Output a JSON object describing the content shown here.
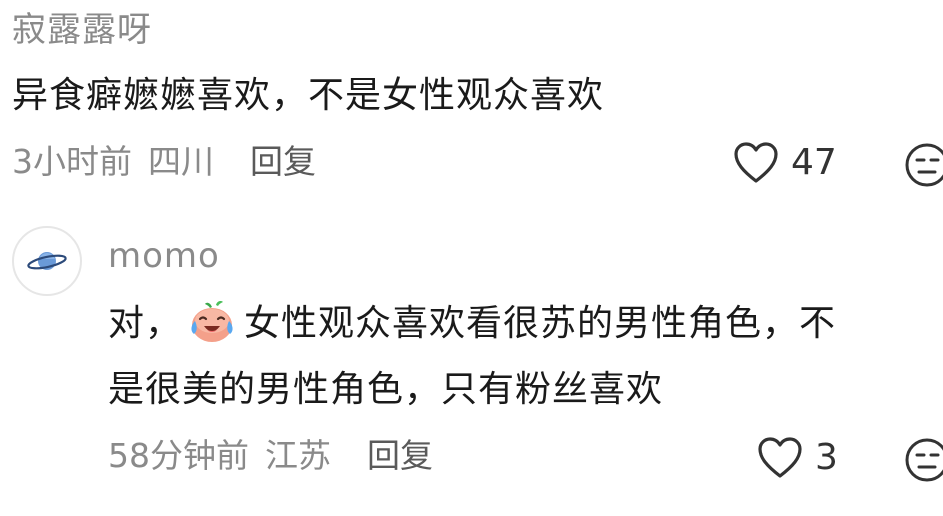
{
  "comments": [
    {
      "username": "寂露露呀",
      "text": "异食癖嬷嬷喜欢，不是女性观众喜欢",
      "time": "3小时前",
      "location": "四川",
      "reply_label": "回复",
      "like_count": "47"
    },
    {
      "username": "momo",
      "avatar_icon": "planet-icon",
      "text_before_emoji": "对，",
      "inline_emoji": "crying-laughing-emoji",
      "text_line_1": "女性观众喜欢看很苏的男性角色，不",
      "text_line_2": "是很美的男性角色，只有粉丝喜欢",
      "time": "58分钟前",
      "location": "江苏",
      "reply_label": "回复",
      "like_count": "3"
    }
  ],
  "colors": {
    "username": "#8a8a8a",
    "body_text": "#1a1a1a",
    "meta_text": "#8a8a8a",
    "reply_text": "#5a5a5a",
    "icon_stroke": "#333333",
    "emoji_face": "#f4a08a",
    "emoji_tear": "#5aa8f0",
    "planet": "#6a9ad8"
  }
}
